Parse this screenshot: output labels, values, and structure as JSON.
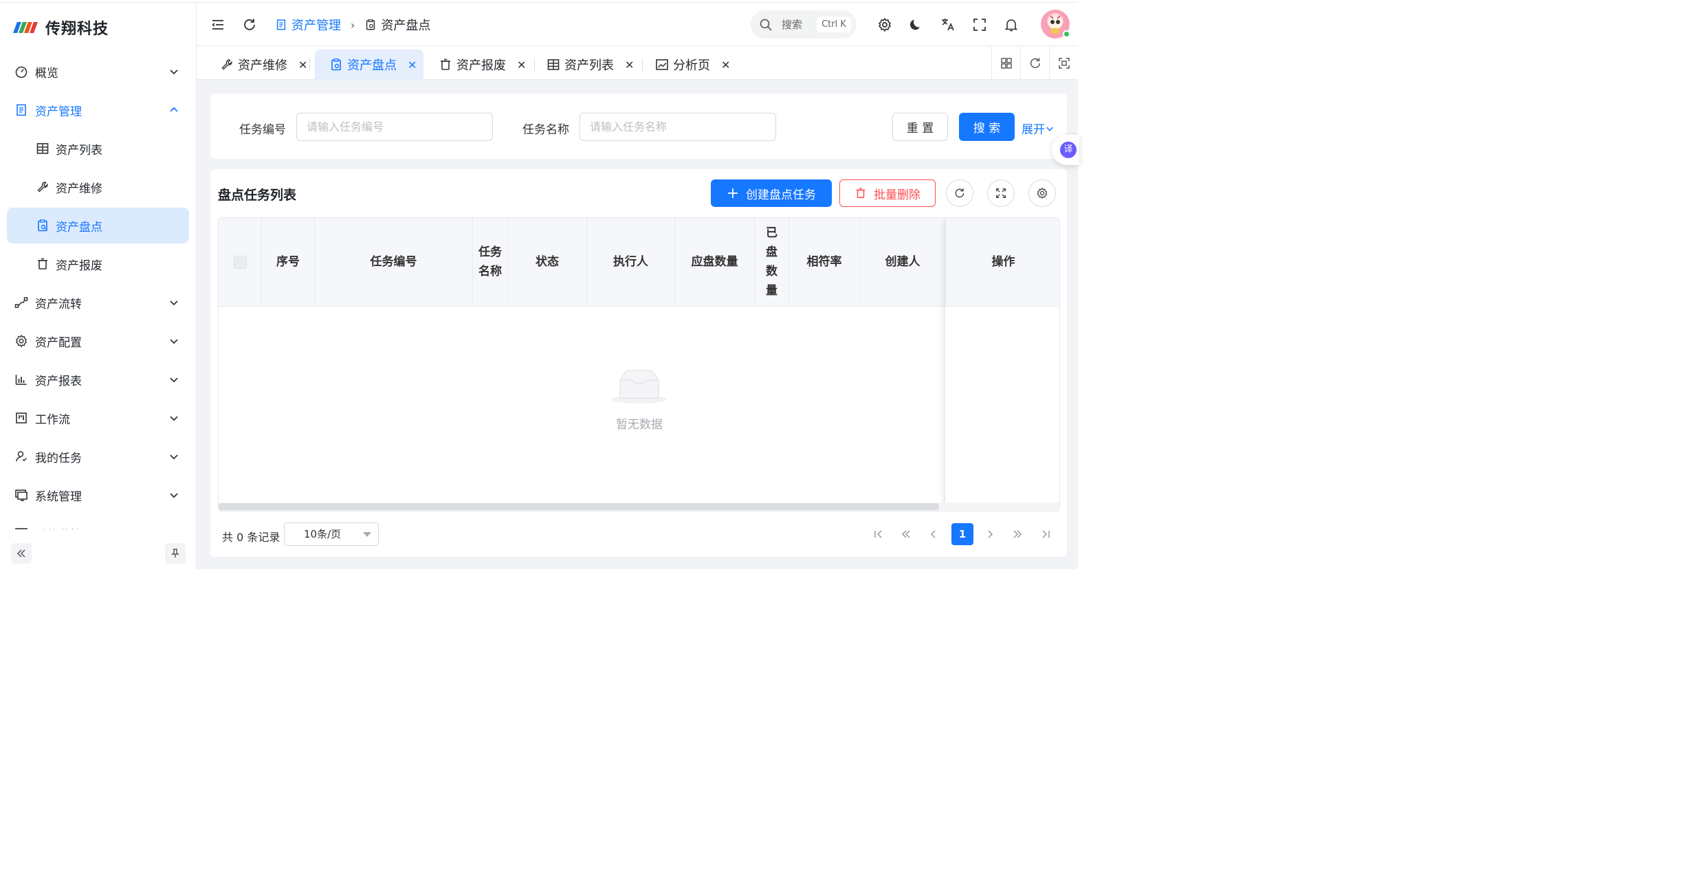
{
  "brand": {
    "name": "传翔科技"
  },
  "sidebar": {
    "items": [
      {
        "label": "概览",
        "icon": "dashboard-icon",
        "state": "collapsed"
      },
      {
        "label": "资产管理",
        "icon": "document-icon",
        "state": "open"
      },
      {
        "label": "资产列表",
        "icon": "table-icon",
        "state": "sub"
      },
      {
        "label": "资产维修",
        "icon": "wrench-icon",
        "state": "sub"
      },
      {
        "label": "资产盘点",
        "icon": "clipboard-icon",
        "state": "active"
      },
      {
        "label": "资产报废",
        "icon": "trash-icon",
        "state": "sub"
      },
      {
        "label": "资产流转",
        "icon": "flow-icon",
        "state": "collapsed"
      },
      {
        "label": "资产配置",
        "icon": "gear-icon",
        "state": "collapsed"
      },
      {
        "label": "资产报表",
        "icon": "bar-chart-icon",
        "state": "collapsed"
      },
      {
        "label": "工作流",
        "icon": "kanban-icon",
        "state": "collapsed"
      },
      {
        "label": "我的任务",
        "icon": "user-icon",
        "state": "collapsed"
      },
      {
        "label": "系统管理",
        "icon": "monitor-icon",
        "state": "collapsed"
      },
      {
        "label": "系统监控",
        "icon": "monitor-chart-icon",
        "state": "collapsed"
      }
    ]
  },
  "header": {
    "breadcrumb": [
      {
        "label": "资产管理",
        "icon": "document-icon"
      },
      {
        "label": "资产盘点",
        "icon": "clipboard-icon"
      }
    ],
    "search": {
      "label": "搜索",
      "shortcut": "Ctrl K"
    }
  },
  "tabs": [
    {
      "label": "资产维修",
      "icon": "wrench-icon",
      "active": false
    },
    {
      "label": "资产盘点",
      "icon": "clipboard-icon",
      "active": true
    },
    {
      "label": "资产报废",
      "icon": "trash-icon",
      "active": false
    },
    {
      "label": "资产列表",
      "icon": "table-icon",
      "active": false
    },
    {
      "label": "分析页",
      "icon": "line-chart-icon",
      "active": false
    }
  ],
  "filters": {
    "task_no_label": "任务编号",
    "task_no_placeholder": "请输入任务编号",
    "task_name_label": "任务名称",
    "task_name_placeholder": "请输入任务名称",
    "reset_label": "重 置",
    "search_label": "搜 索",
    "expand_label": "展开"
  },
  "side_chip": {
    "label": "译"
  },
  "list": {
    "title": "盘点任务列表",
    "create_label": "创建盘点任务",
    "batch_delete_label": "批量删除",
    "columns": [
      "序号",
      "任务编号",
      "任务名称",
      "状态",
      "执行人",
      "应盘数量",
      "已盘数量",
      "相符率",
      "创建人",
      "操作"
    ],
    "rows": [],
    "empty_text": "暂无数据"
  },
  "pagination": {
    "total_text": "共 0 条记录",
    "page_size": "10条/页",
    "current_page": "1"
  },
  "colors": {
    "primary": "#1677ff",
    "danger": "#ff4d4f",
    "active_bg": "#dceafe"
  }
}
